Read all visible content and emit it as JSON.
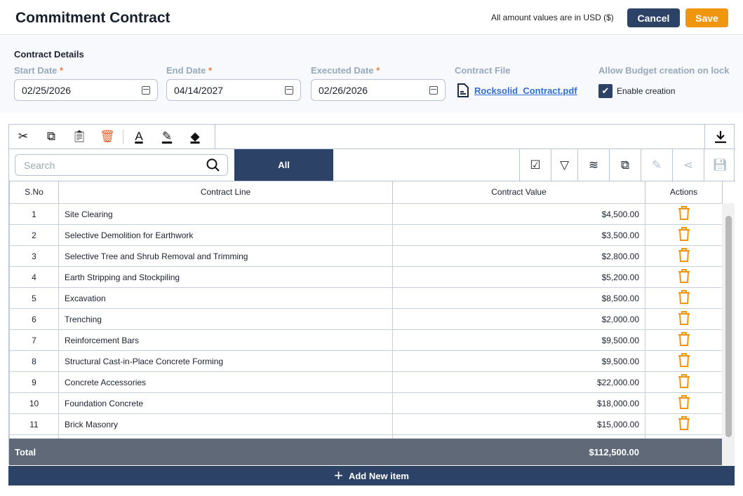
{
  "header": {
    "title": "Commitment Contract",
    "note": "All amount values are in USD ($)",
    "cancel": "Cancel",
    "save": "Save"
  },
  "form": {
    "section": "Contract Details",
    "start_label": "Start Date",
    "end_label": "End Date",
    "exec_label": "Executed Date",
    "required": "*",
    "start": "02/25/2026",
    "end": "04/14/2027",
    "executed": "02/26/2026",
    "file_label": "Contract File",
    "file": "Rocksolid_Contract.pdf",
    "budget_label": "Allow Budget creation on lock",
    "checkbox": "Enable creation",
    "checked": true
  },
  "grid": {
    "search_placeholder": "Search",
    "filter_all": "All",
    "columns": [
      "S.No",
      "Contract Line",
      "Contract Value",
      "Actions"
    ],
    "rows": [
      {
        "no": "1",
        "line": "Site Clearing",
        "value": "$4,500.00"
      },
      {
        "no": "2",
        "line": "Selective Demolition for Earthwork",
        "value": "$3,500.00"
      },
      {
        "no": "3",
        "line": "Selective Tree and Shrub Removal and Trimming",
        "value": "$2,800.00"
      },
      {
        "no": "4",
        "line": "Earth Stripping and Stockpiling",
        "value": "$5,200.00"
      },
      {
        "no": "5",
        "line": "Excavation",
        "value": "$8,500.00"
      },
      {
        "no": "6",
        "line": "Trenching",
        "value": "$2,000.00"
      },
      {
        "no": "7",
        "line": "Reinforcement Bars",
        "value": "$9,500.00"
      },
      {
        "no": "8",
        "line": "Structural Cast-in-Place Concrete Forming",
        "value": "$9,500.00"
      },
      {
        "no": "9",
        "line": "Concrete Accessories",
        "value": "$22,000.00"
      },
      {
        "no": "10",
        "line": "Foundation Concrete",
        "value": "$18,000.00"
      },
      {
        "no": "11",
        "line": "Brick Masonry",
        "value": "$15,000.00"
      }
    ],
    "total_label": "Total",
    "total": "$112,500.00",
    "add": "Add New item"
  },
  "colors": {
    "primary": "#2c4267",
    "accent": "#f0960e"
  }
}
